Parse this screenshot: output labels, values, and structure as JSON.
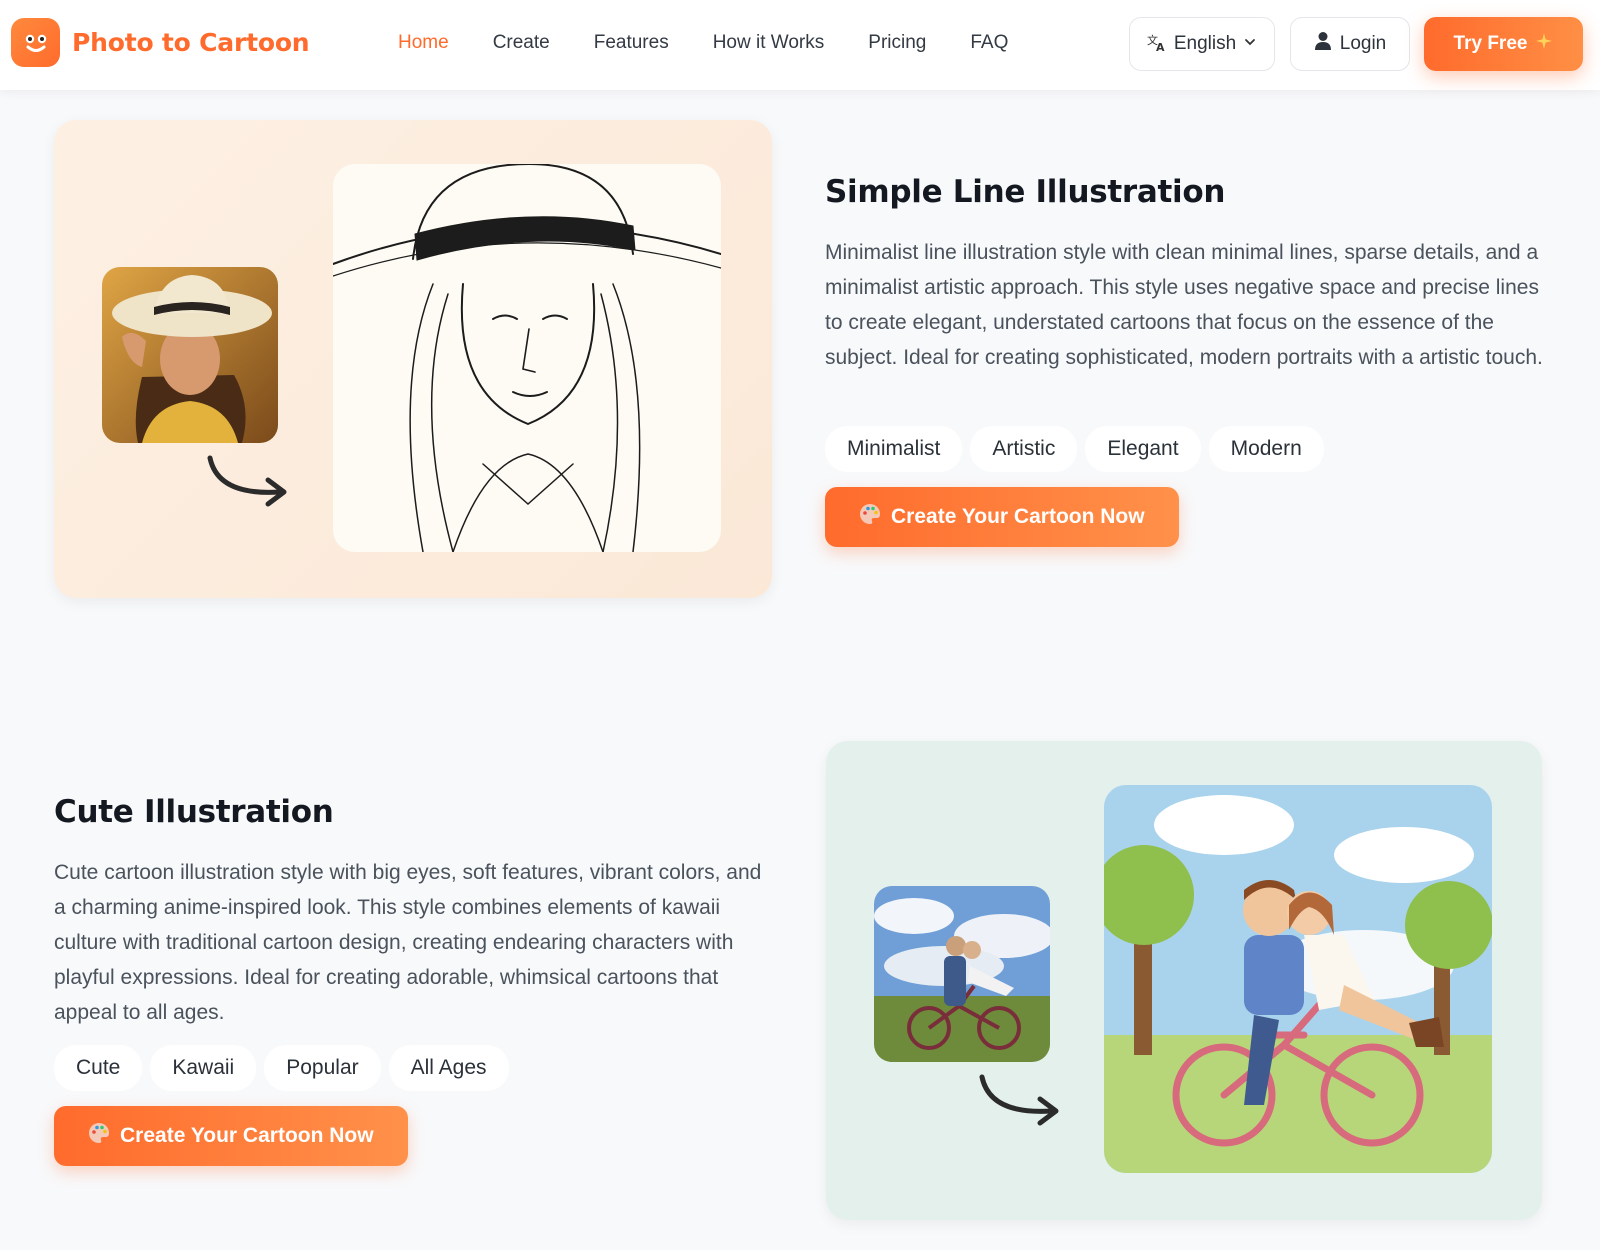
{
  "header": {
    "logo_text": "Photo to Cartoon",
    "nav": [
      {
        "label": "Home",
        "active": true
      },
      {
        "label": "Create",
        "active": false
      },
      {
        "label": "Features",
        "active": false
      },
      {
        "label": "How it Works",
        "active": false
      },
      {
        "label": "Pricing",
        "active": false
      },
      {
        "label": "FAQ",
        "active": false
      }
    ],
    "language_label": "English",
    "login_label": "Login",
    "try_free_label": "Try Free"
  },
  "sections": [
    {
      "title": "Simple Line Illustration",
      "description": "Minimalist line illustration style with clean minimal lines, sparse details, and a minimalist artistic approach. This style uses negative space and precise lines to create elegant, understated cartoons that focus on the essence of the subject. Ideal for creating sophisticated, modern portraits with a artistic touch.",
      "tags": [
        "Minimalist",
        "Artistic",
        "Elegant",
        "Modern"
      ],
      "cta_label": "Create Your Cartoon Now"
    },
    {
      "title": "Cute Illustration",
      "description": "Cute cartoon illustration style with big eyes, soft features, vibrant colors, and a charming anime-inspired look. This style combines elements of kawaii culture with traditional cartoon design, creating endearing characters with playful expressions. Ideal for creating adorable, whimsical cartoons that appeal to all ages.",
      "tags": [
        "Cute",
        "Kawaii",
        "Popular",
        "All Ages"
      ],
      "cta_label": "Create Your Cartoon Now"
    }
  ],
  "colors": {
    "accent": "#ff6b2c",
    "card_warm": "#fbe8d7",
    "card_mint": "#e3f0ec",
    "page_bg": "#f8f9fb"
  },
  "icons": [
    "smiley-logo-icon",
    "translate-icon",
    "chevron-down-icon",
    "user-icon",
    "sparkle-icon",
    "palette-icon",
    "curved-arrow-icon"
  ]
}
